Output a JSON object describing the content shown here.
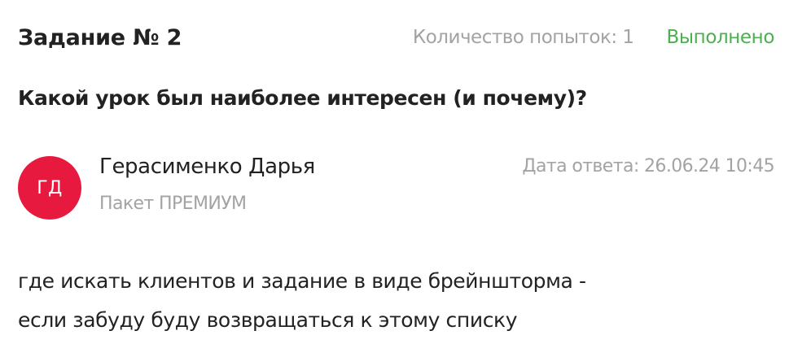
{
  "task": {
    "title": "Задание № 2",
    "attempts": "Количество попыток: 1",
    "status": "Выполнено",
    "question": "Какой урок был наиболее интересен (и почему)?"
  },
  "answer": {
    "author": {
      "initials": "ГД",
      "name": "Герасименко Дарья",
      "package": "Пакет ПРЕМИУМ"
    },
    "date": "Дата ответа: 26.06.24 10:45",
    "lines": [
      "где искать клиентов и задание в виде брейншторма -",
      "если забуду буду возвращаться к этому списку"
    ]
  },
  "colors": {
    "status": "#4caf50",
    "avatar": "#e8193e",
    "muted": "#a3a3a3",
    "text": "#222222"
  }
}
